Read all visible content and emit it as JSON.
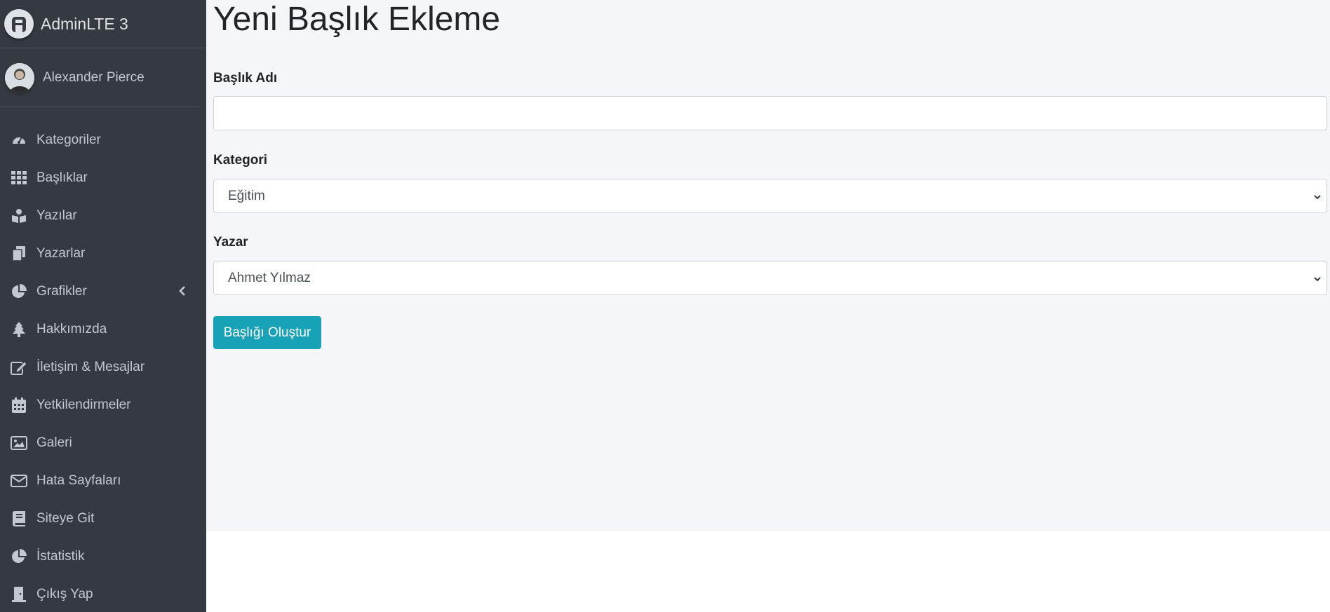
{
  "brand": {
    "title": "AdminLTE 3"
  },
  "user": {
    "name": "Alexander Pierce"
  },
  "sidebar": {
    "items": [
      {
        "label": "Kategoriler",
        "icon": "tachometer-icon"
      },
      {
        "label": "Başlıklar",
        "icon": "grid-icon"
      },
      {
        "label": "Yazılar",
        "icon": "reader-icon"
      },
      {
        "label": "Yazarlar",
        "icon": "copy-icon"
      },
      {
        "label": "Grafikler",
        "icon": "chart-pie-icon",
        "has_submenu": true
      },
      {
        "label": "Hakkımızda",
        "icon": "tree-icon"
      },
      {
        "label": "İletişim & Mesajlar",
        "icon": "edit-icon"
      },
      {
        "label": "Yetkilendirmeler",
        "icon": "calendar-icon"
      },
      {
        "label": "Galeri",
        "icon": "image-icon"
      },
      {
        "label": "Hata Sayfaları",
        "icon": "envelope-icon"
      },
      {
        "label": "Siteye Git",
        "icon": "book-icon"
      },
      {
        "label": "İstatistik",
        "icon": "chart-pie-icon"
      },
      {
        "label": "Çıkış Yap",
        "icon": "door-icon"
      }
    ]
  },
  "main": {
    "title": "Yeni Başlık Ekleme",
    "form": {
      "title_label": "Başlık Adı",
      "title_value": "",
      "category_label": "Kategori",
      "category_selected": "Eğitim",
      "author_label": "Yazar",
      "author_selected": "Ahmet Yılmaz",
      "submit_label": "Başlığı Oluştur"
    }
  },
  "colors": {
    "sidebar_bg": "#343a40",
    "content_bg": "#f4f6f9",
    "button_bg": "#17a2b8",
    "sidebar_text": "#c2c7d0"
  }
}
